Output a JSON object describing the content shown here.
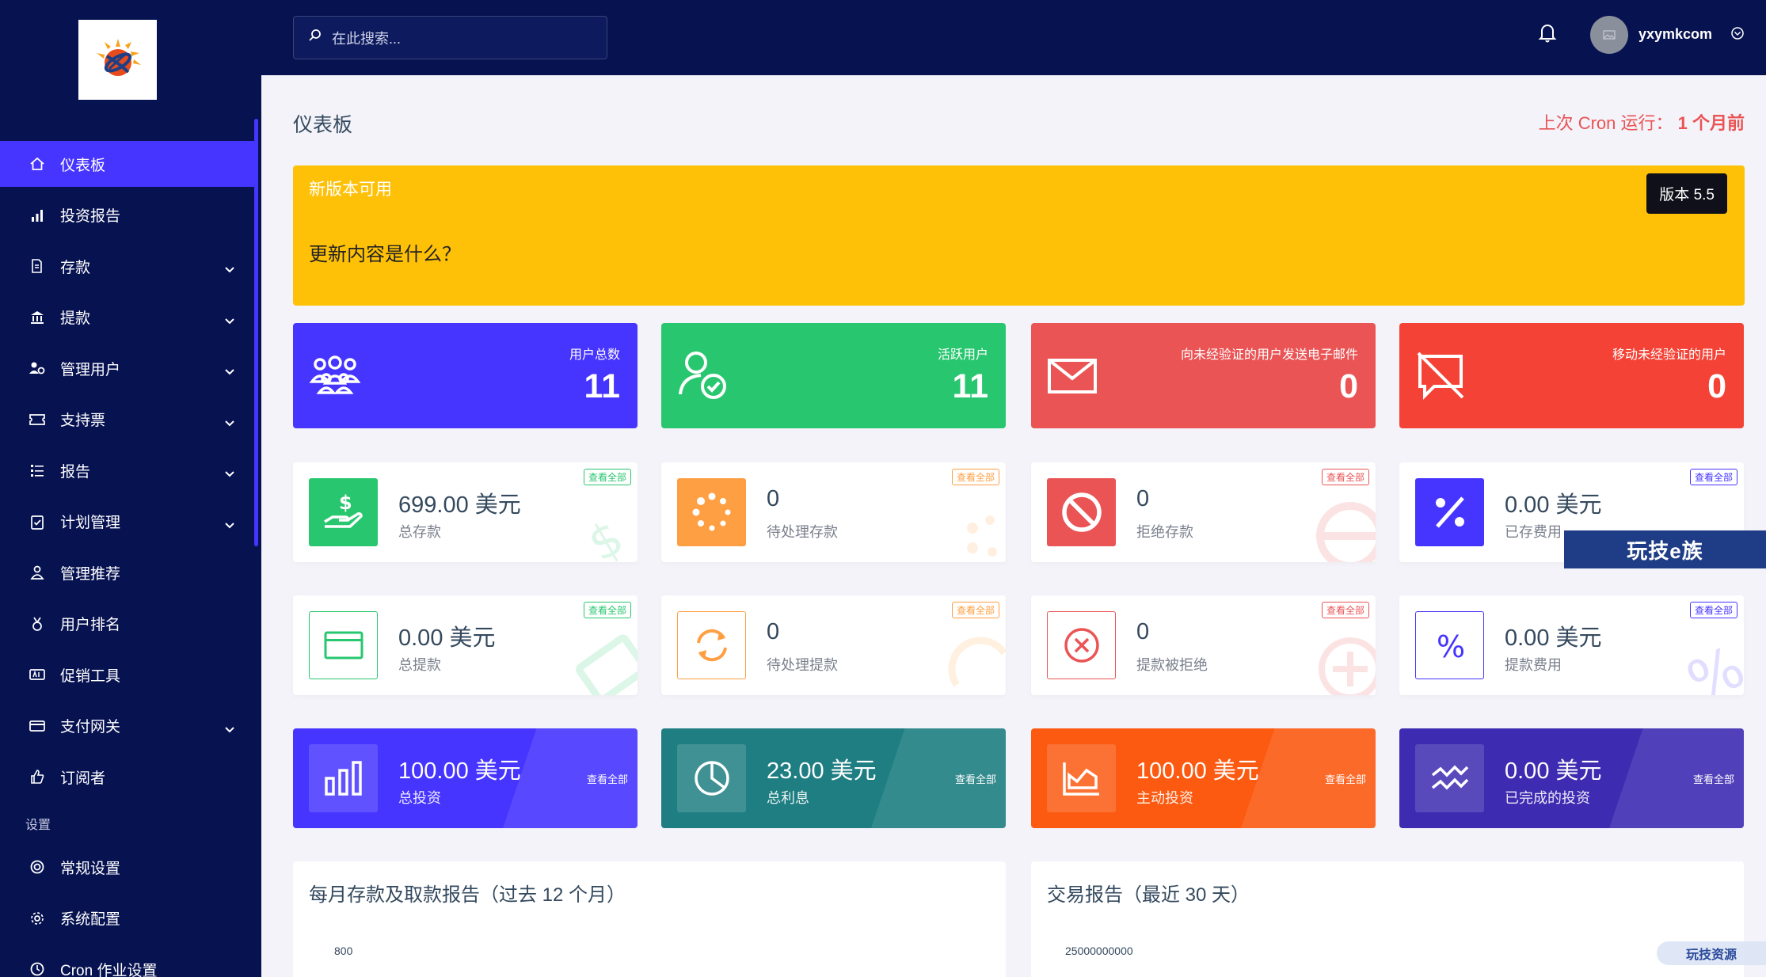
{
  "topbar": {
    "search_placeholder": "在此搜索...",
    "username": "yxymkcom"
  },
  "sidebar": {
    "items": [
      {
        "label": "仪表板",
        "icon": "home-icon"
      },
      {
        "label": "投资报告",
        "icon": "bar-chart-icon"
      },
      {
        "label": "存款",
        "icon": "deposit-icon"
      },
      {
        "label": "提款",
        "icon": "bank-icon"
      },
      {
        "label": "管理用户",
        "icon": "users-cog-icon"
      },
      {
        "label": "支持票",
        "icon": "ticket-icon"
      },
      {
        "label": "报告",
        "icon": "list-icon"
      },
      {
        "label": "计划管理",
        "icon": "clipboard-check-icon"
      },
      {
        "label": "管理推荐",
        "icon": "user-tie-icon"
      },
      {
        "label": "用户排名",
        "icon": "medal-icon"
      },
      {
        "label": "促销工具",
        "icon": "ad-icon"
      },
      {
        "label": "支付网关",
        "icon": "credit-card-icon"
      },
      {
        "label": "订阅者",
        "icon": "thumbs-up-icon"
      }
    ],
    "section_settings": "设置",
    "settings_items": [
      {
        "label": "常规设置",
        "icon": "life-ring-icon"
      },
      {
        "label": "系统配置",
        "icon": "gear-icon"
      },
      {
        "label": "Cron 作业设置",
        "icon": "clock-icon"
      }
    ]
  },
  "header": {
    "title": "仪表板",
    "cron_label": "上次 Cron 运行：",
    "cron_value": "1 个月前"
  },
  "banner": {
    "title": "新版本可用",
    "body": "更新内容是什么？",
    "version": "版本 5.5"
  },
  "widgets": [
    {
      "label": "用户总数",
      "value": "11",
      "color": "#4634ff"
    },
    {
      "label": "活跃用户",
      "value": "11",
      "color": "#28c76f"
    },
    {
      "label": "向未经验证的用户发送电子邮件",
      "value": "0",
      "color": "#ea5455"
    },
    {
      "label": "移动未经验证的用户",
      "value": "0",
      "color": "#f44336"
    }
  ],
  "view_all": "查看全部",
  "cards_deposit": [
    {
      "value": "699.00 美元",
      "label": "总存款",
      "color": "#28c76f"
    },
    {
      "value": "0",
      "label": "待处理存款",
      "color": "#ff9f43"
    },
    {
      "value": "0",
      "label": "拒绝存款",
      "color": "#ea5455"
    },
    {
      "value": "0.00 美元",
      "label": "已存费用",
      "color": "#4634ff"
    }
  ],
  "cards_withdraw": [
    {
      "value": "0.00 美元",
      "label": "总提款",
      "color": "#28c76f"
    },
    {
      "value": "0",
      "label": "待处理提款",
      "color": "#ff9f43"
    },
    {
      "value": "0",
      "label": "提款被拒绝",
      "color": "#ea5455"
    },
    {
      "value": "0.00 美元",
      "label": "提款费用",
      "color": "#4634ff"
    }
  ],
  "cards_invest": [
    {
      "value": "100.00 美元",
      "label": "总投资",
      "color": "#4634ff"
    },
    {
      "value": "23.00 美元",
      "label": "总利息",
      "color": "#1e7e82"
    },
    {
      "value": "100.00 美元",
      "label": "主动投资",
      "color": "#fc5a11"
    },
    {
      "value": "0.00 美元",
      "label": "已完成的投资",
      "color": "#3d2bb1"
    }
  ],
  "panels": {
    "deposit_report_title": "每月存款及取款报告（过去 12 个月）",
    "deposit_report_tick": "800",
    "transaction_report_title": "交易报告（最近 30 天）",
    "transaction_report_tick": "25000000000"
  },
  "watermark": {
    "main": "玩技e族",
    "corner": "玩技资源"
  }
}
